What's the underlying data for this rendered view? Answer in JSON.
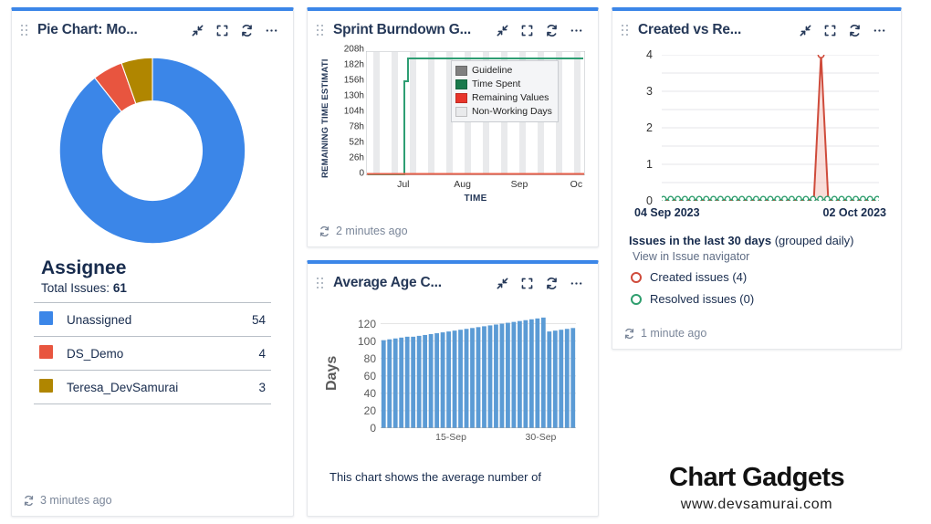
{
  "theme": {
    "accent_top_border": "#3b86e8",
    "blue": "#3b86e8",
    "red": "#e8553f",
    "gold": "#b08600",
    "green": "#2f9e6e",
    "crimson": "#cf4b3b"
  },
  "icons": {
    "drag": "drag-handle-icon",
    "collapse": "collapse-icon",
    "maximize": "maximize-icon",
    "refresh": "refresh-icon",
    "more": "more-options-icon"
  },
  "gadgets": {
    "pie": {
      "title": "Pie Chart: Mo...",
      "heading": "Assignee",
      "total_label": "Total Issues:",
      "total_value": "61",
      "footer": "3 minutes ago",
      "legend": [
        {
          "color": "#3b86e8",
          "label": "Unassigned",
          "value": "54"
        },
        {
          "color": "#e8553f",
          "label": "DS_Demo",
          "value": "4"
        },
        {
          "color": "#b08600",
          "label": "Teresa_DevSamurai",
          "value": "3"
        }
      ]
    },
    "burndown": {
      "title": "Sprint Burndown G...",
      "footer": "2 minutes ago",
      "legend": [
        {
          "color": "#808080",
          "label": "Guideline"
        },
        {
          "color": "#1a7a4c",
          "label": "Time Spent"
        },
        {
          "color": "#e8352b",
          "label": "Remaining Values"
        },
        {
          "color": "#e9eaec",
          "label": "Non-Working Days"
        }
      ]
    },
    "created_vs_resolved": {
      "title": "Created vs Re...",
      "info_title_bold": "Issues in the last 30 days",
      "info_title_rest": " (grouped daily)",
      "navigator_link": "View in Issue navigator",
      "series_labels": [
        {
          "label": "Created issues (4)",
          "color": "#cf4b3b"
        },
        {
          "label": "Resolved issues (0)",
          "color": "#2f9e6e"
        }
      ],
      "footer": "1 minute ago"
    },
    "average_age": {
      "title": "Average Age C...",
      "description": "This chart shows the average number of"
    }
  },
  "brand": {
    "name": "Chart Gadgets",
    "url": "www.devsamurai.com"
  },
  "chart_data": [
    {
      "type": "pie",
      "title": "Assignee",
      "subtitle": "Total Issues: 61",
      "labels": [
        "Unassigned",
        "DS_Demo",
        "Teresa_DevSamurai"
      ],
      "values": [
        54,
        4,
        3
      ],
      "colors": [
        "#3b86e8",
        "#e8553f",
        "#b08600"
      ],
      "donut": true,
      "total": 61,
      "legend_position": "bottom"
    },
    {
      "type": "line",
      "title": "Sprint Burndown Gadget",
      "xlabel": "TIME",
      "ylabel": "REMAINING TIME ESTIMATI",
      "yticks": [
        "0",
        "26h",
        "52h",
        "78h",
        "104h",
        "130h",
        "156h",
        "182h",
        "208h"
      ],
      "ylim": [
        0,
        208
      ],
      "xticks": [
        "Jul",
        "Aug",
        "Sep",
        "Oc"
      ],
      "grid": true,
      "legend_position": "inside-top-right",
      "series": [
        {
          "name": "Guideline",
          "color": "#808080",
          "values": []
        },
        {
          "name": "Time Spent",
          "color": "#1a7a4c",
          "x": [
            0,
            16,
            17,
            17,
            20,
            21,
            100
          ],
          "values": [
            0,
            0,
            0,
            160,
            160,
            200,
            200
          ]
        },
        {
          "name": "Remaining Values",
          "color": "#e8352b",
          "x": [
            0,
            100
          ],
          "values": [
            0,
            0
          ]
        }
      ]
    },
    {
      "type": "line",
      "title": "Created vs Resolved",
      "xticks": [
        "04 Sep 2023",
        "02 Oct 2023"
      ],
      "yticks": [
        "0",
        "1",
        "2",
        "3",
        "4"
      ],
      "ylim": [
        0,
        4
      ],
      "grid": true,
      "series": [
        {
          "name": "Created issues",
          "color": "#cf4b3b",
          "total": 4,
          "values": [
            0,
            0,
            0,
            0,
            0,
            0,
            0,
            0,
            0,
            0,
            0,
            0,
            0,
            0,
            0,
            0,
            0,
            0,
            0,
            0,
            0,
            0,
            0,
            0,
            0,
            0,
            0,
            4,
            0,
            0,
            0
          ]
        },
        {
          "name": "Resolved issues",
          "color": "#2f9e6e",
          "total": 0,
          "values": [
            0,
            0,
            0,
            0,
            0,
            0,
            0,
            0,
            0,
            0,
            0,
            0,
            0,
            0,
            0,
            0,
            0,
            0,
            0,
            0,
            0,
            0,
            0,
            0,
            0,
            0,
            0,
            0,
            0,
            0,
            0
          ]
        }
      ]
    },
    {
      "type": "bar",
      "title": "Average Age Chart",
      "ylabel": "Days",
      "ylim": [
        0,
        130
      ],
      "yticks": [
        "0",
        "20",
        "40",
        "60",
        "80",
        "100",
        "120"
      ],
      "xticks": [
        "15-Sep",
        "30-Sep"
      ],
      "color": "#5b9bd5",
      "values": [
        101,
        102,
        103,
        104,
        105,
        105,
        106,
        107,
        108,
        109,
        110,
        111,
        112,
        113,
        114,
        115,
        116,
        117,
        118,
        119,
        120,
        121,
        122,
        123,
        124,
        125,
        126,
        127,
        111,
        112,
        113,
        114,
        115
      ]
    }
  ]
}
